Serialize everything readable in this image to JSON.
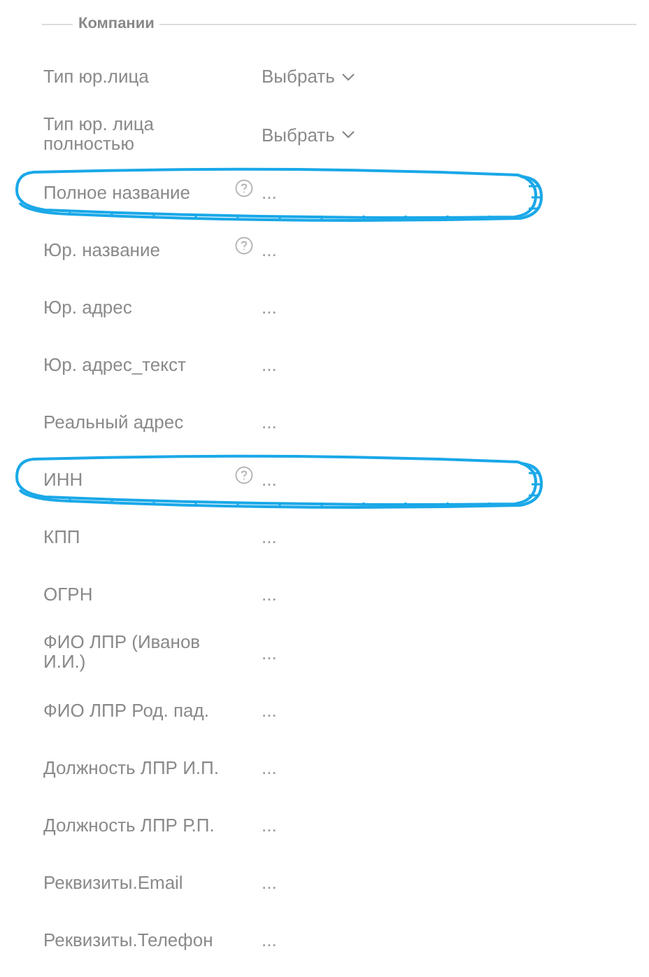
{
  "section": {
    "title": "Компании"
  },
  "fields": [
    {
      "label": "Тип юр.лица",
      "kind": "select",
      "value": "Выбрать",
      "help": false,
      "highlighted": false
    },
    {
      "label": "Тип юр. лица полностью",
      "kind": "select",
      "value": "Выбрать",
      "help": false,
      "highlighted": false
    },
    {
      "label": "Полное название",
      "kind": "text",
      "value": "...",
      "help": true,
      "highlighted": true
    },
    {
      "label": "Юр. название",
      "kind": "text",
      "value": "...",
      "help": true,
      "highlighted": false
    },
    {
      "label": "Юр. адрес",
      "kind": "text",
      "value": "...",
      "help": false,
      "highlighted": false
    },
    {
      "label": "Юр. адрес_текст",
      "kind": "text",
      "value": "...",
      "help": false,
      "highlighted": false
    },
    {
      "label": "Реальный адрес",
      "kind": "text",
      "value": "...",
      "help": false,
      "highlighted": false
    },
    {
      "label": "ИНН",
      "kind": "text",
      "value": "...",
      "help": true,
      "highlighted": true
    },
    {
      "label": "КПП",
      "kind": "text",
      "value": "...",
      "help": false,
      "highlighted": false
    },
    {
      "label": "ОГРН",
      "kind": "text",
      "value": "...",
      "help": false,
      "highlighted": false
    },
    {
      "label": "ФИО ЛПР (Иванов И.И.)",
      "kind": "text",
      "value": "...",
      "help": false,
      "highlighted": false
    },
    {
      "label": "ФИО ЛПР Род. пад.",
      "kind": "text",
      "value": "...",
      "help": false,
      "highlighted": false
    },
    {
      "label": "Должность ЛПР И.П.",
      "kind": "text",
      "value": "...",
      "help": false,
      "highlighted": false
    },
    {
      "label": "Должность ЛПР Р.П.",
      "kind": "text",
      "value": "...",
      "help": false,
      "highlighted": false
    },
    {
      "label": "Реквизиты.Email",
      "kind": "text",
      "value": "...",
      "help": false,
      "highlighted": false
    },
    {
      "label": "Реквизиты.Телефон",
      "kind": "text",
      "value": "...",
      "help": false,
      "highlighted": false
    }
  ]
}
